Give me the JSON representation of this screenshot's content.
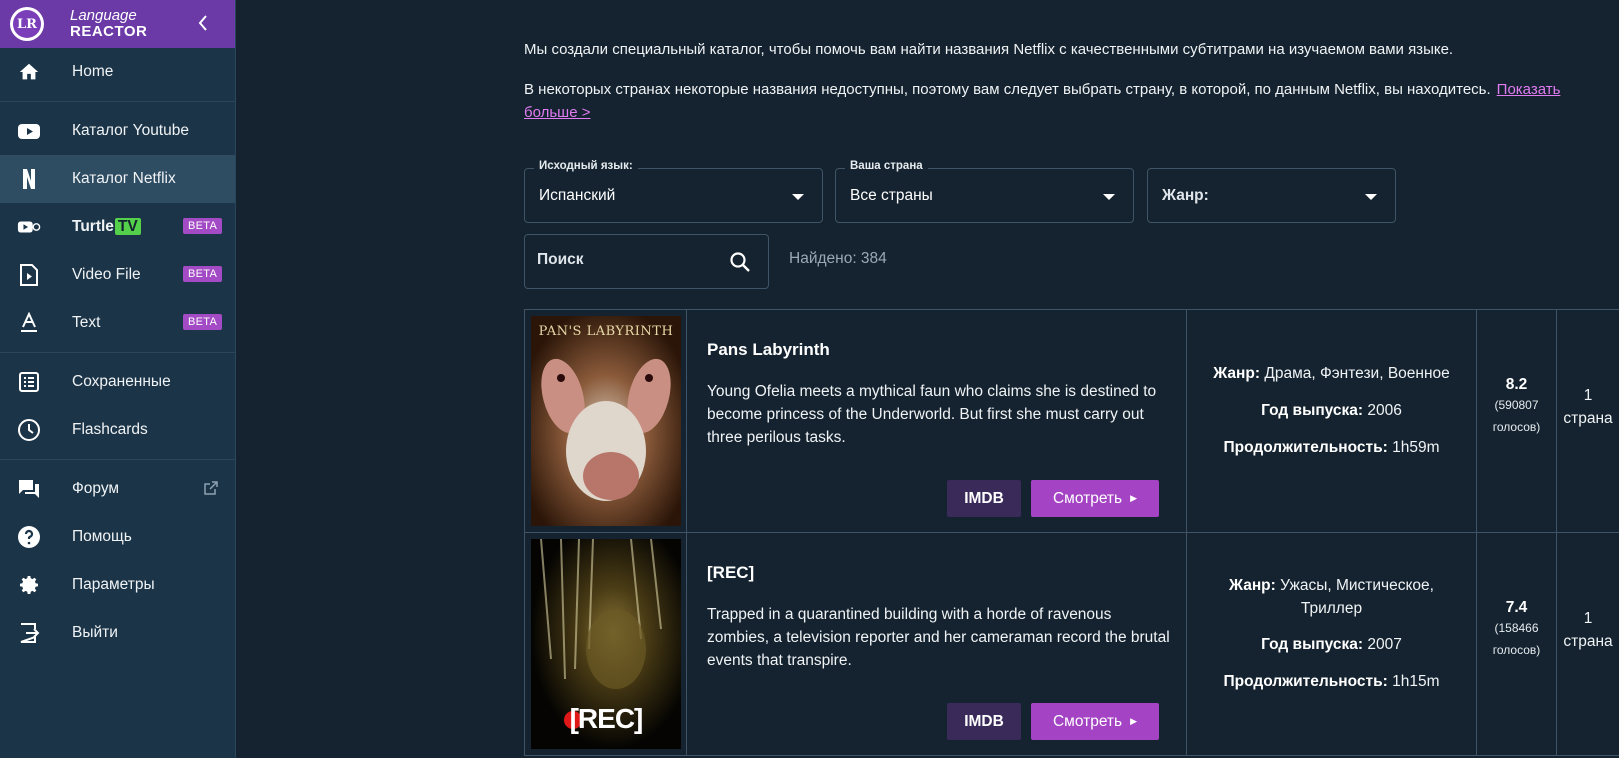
{
  "brand": {
    "logo": "LR",
    "line1": "Language",
    "line2": "REACTOR"
  },
  "nav": {
    "home": "Home",
    "youtube": "Каталог Youtube",
    "netflix": "Каталог Netflix",
    "turtle": "Turtle",
    "turtle_tv": "TV",
    "video_file": "Video File",
    "text": "Text",
    "saved": "Сохраненные",
    "flashcards": "Flashcards",
    "forum": "Форум",
    "help": "Помощь",
    "settings": "Параметры",
    "logout": "Выйти",
    "beta": "BETA"
  },
  "intro": {
    "p1": "Мы создали специальный каталог, чтобы помочь вам найти названия Netflix с качественными субтитрами на изучаемом вами языке.",
    "p2": "В некоторых странах некоторые названия недоступны, поэтому вам следует выбрать страну, в которой, по данным Netflix, вы находитесь.",
    "more_link": "Показать больше >"
  },
  "filters": {
    "source_lang": {
      "label": "Исходный язык:",
      "value": "Испанский"
    },
    "country": {
      "label": "Ваша страна",
      "value": "Все страны"
    },
    "genre": {
      "placeholder": "Жанр:"
    },
    "search": {
      "placeholder": "Поиск"
    },
    "found": "Найдено: 384"
  },
  "labels": {
    "genre": "Жанр:",
    "year": "Год выпуска:",
    "duration": "Продолжительность:",
    "imdb": "IMDB",
    "watch": "Смотреть"
  },
  "movies": [
    {
      "title": "Pans Labyrinth",
      "poster_text": "PAN'S LABYRINTH",
      "description": "Young Ofelia meets a mythical faun who claims she is destined to become princess of the Underworld. But first she must carry out three perilous tasks.",
      "genre": "Драма, Фэнтези, Военное",
      "year": "2006",
      "duration": "1h59m",
      "rating": "8.2",
      "votes": "(590807 голосов)",
      "countries": "1 страна"
    },
    {
      "title": "[REC]",
      "poster_text": "[REC]",
      "description": "Trapped in a quarantined building with a horde of ravenous zombies, a television reporter and her cameraman record the brutal events that transpire.",
      "genre": "Ужасы, Мистическое, Триллер",
      "year": "2007",
      "duration": "1h15m",
      "rating": "7.4",
      "votes": "(158466 голосов)",
      "countries": "1 страна"
    }
  ]
}
